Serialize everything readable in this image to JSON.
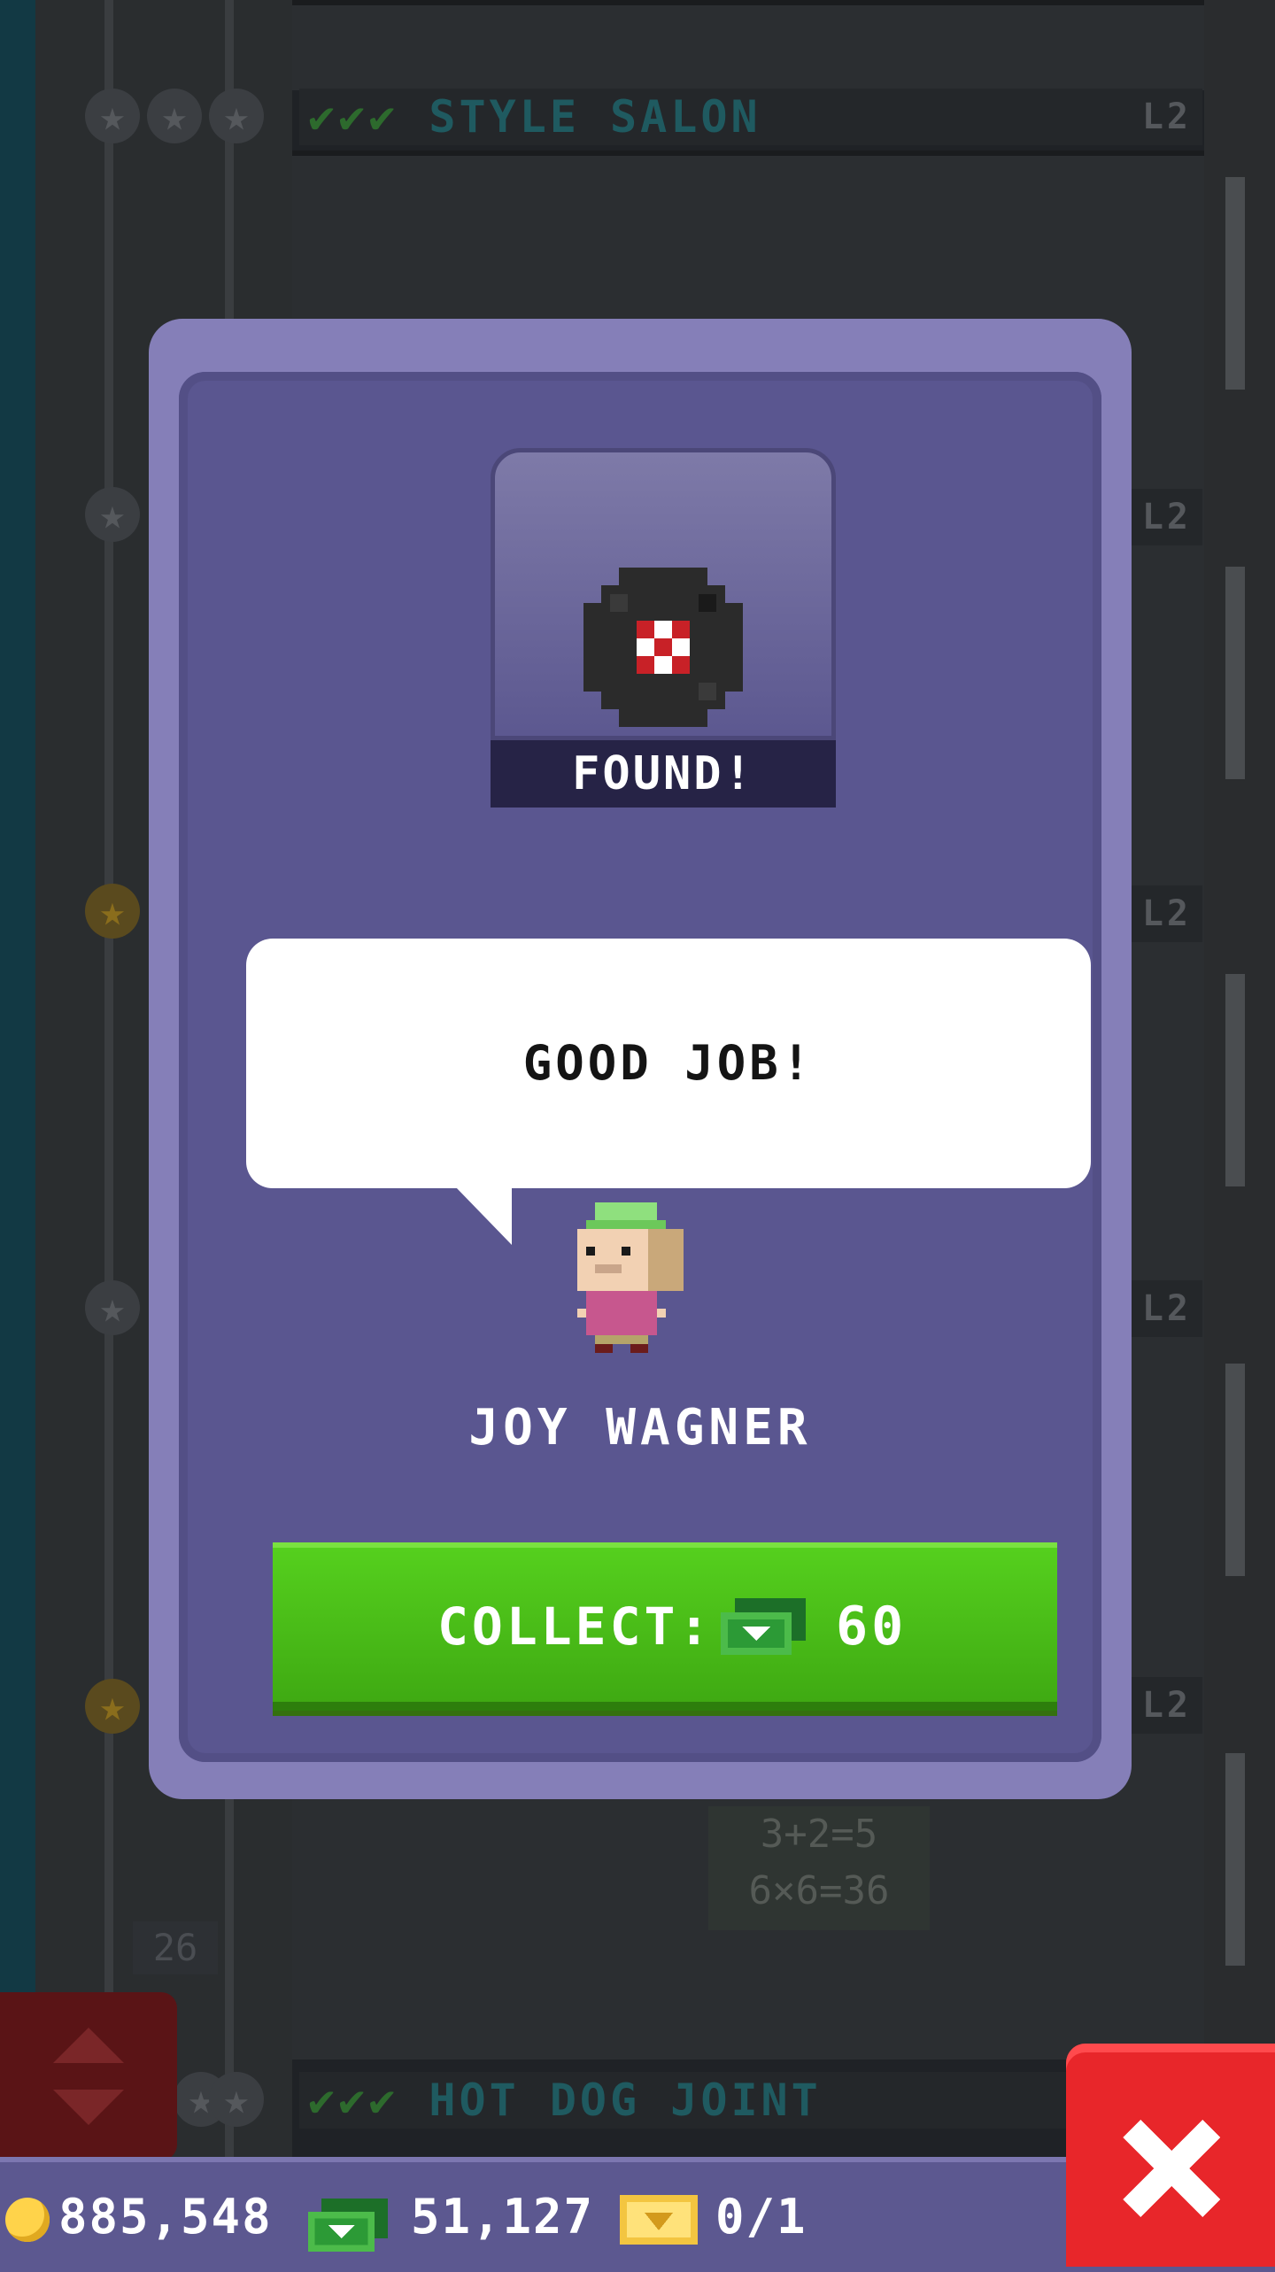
{
  "tower": {
    "floors": [
      {
        "name": "STYLE SALON",
        "level": "L2"
      },
      {
        "name": "HOT DOG JOINT",
        "level": ""
      }
    ],
    "side_levels": [
      "L2",
      "L2",
      "L2",
      "L2"
    ],
    "chalkboard": [
      "3+2=5",
      "6×6=36"
    ],
    "floor_number": "26"
  },
  "dialog": {
    "item_status": "FOUND!",
    "item_icon": "vinyl-record-icon",
    "speech": "GOOD JOB!",
    "character_name": "JOY WAGNER",
    "collect": {
      "label": "COLLECT:",
      "currency_icon": "tower-bux-icon",
      "amount": "60"
    }
  },
  "hud": {
    "coins": "885,548",
    "bux": "51,127",
    "tickets": "0/1"
  },
  "colors": {
    "dialog_frame": "#857fb8",
    "dialog_panel": "#5a5690",
    "collect_green": "#4cc41a",
    "close_red": "#e8262a"
  }
}
